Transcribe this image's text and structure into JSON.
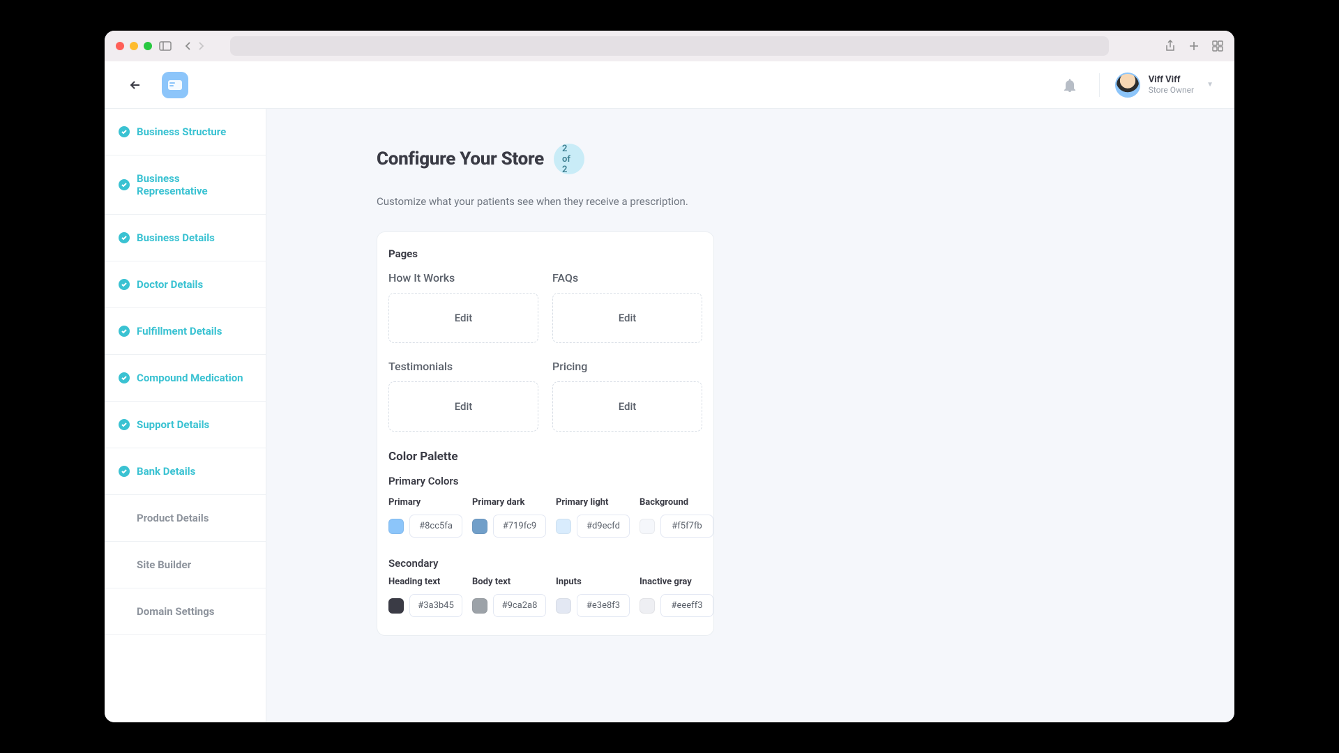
{
  "user": {
    "name": "Viff Viff",
    "role": "Store Owner"
  },
  "sidebar": {
    "items": [
      {
        "label": "Business Structure",
        "done": true
      },
      {
        "label": "Business Representative",
        "done": true
      },
      {
        "label": "Business Details",
        "done": true
      },
      {
        "label": "Doctor Details",
        "done": true
      },
      {
        "label": "Fulfillment Details",
        "done": true
      },
      {
        "label": "Compound Medication",
        "done": true
      },
      {
        "label": "Support Details",
        "done": true
      },
      {
        "label": "Bank Details",
        "done": true
      },
      {
        "label": "Product Details",
        "done": false
      },
      {
        "label": "Site Builder",
        "done": false
      },
      {
        "label": "Domain Settings",
        "done": false
      }
    ]
  },
  "main": {
    "title": "Configure Your Store",
    "step": "2 of 2",
    "subtitle": "Customize what your patients see when they receive a prescription.",
    "pages_card_title": "Pages",
    "pages": [
      {
        "label": "How It Works",
        "action": "Edit"
      },
      {
        "label": "FAQs",
        "action": "Edit"
      },
      {
        "label": "Testimonials",
        "action": "Edit"
      },
      {
        "label": "Pricing",
        "action": "Edit"
      }
    ],
    "palette_title": "Color Palette",
    "primary_title": "Primary Colors",
    "primary_colors": [
      {
        "label": "Primary",
        "hex": "#8cc5fa"
      },
      {
        "label": "Primary dark",
        "hex": "#719fc9"
      },
      {
        "label": "Primary light",
        "hex": "#d9ecfd"
      },
      {
        "label": "Background",
        "hex": "#f5f7fb"
      }
    ],
    "secondary_title": "Secondary",
    "secondary_colors": [
      {
        "label": "Heading text",
        "hex": "#3a3b45"
      },
      {
        "label": "Body text",
        "hex": "#9ca2a8"
      },
      {
        "label": "Inputs",
        "hex": "#e3e8f3"
      },
      {
        "label": "Inactive gray",
        "hex": "#eeeff3"
      }
    ]
  }
}
